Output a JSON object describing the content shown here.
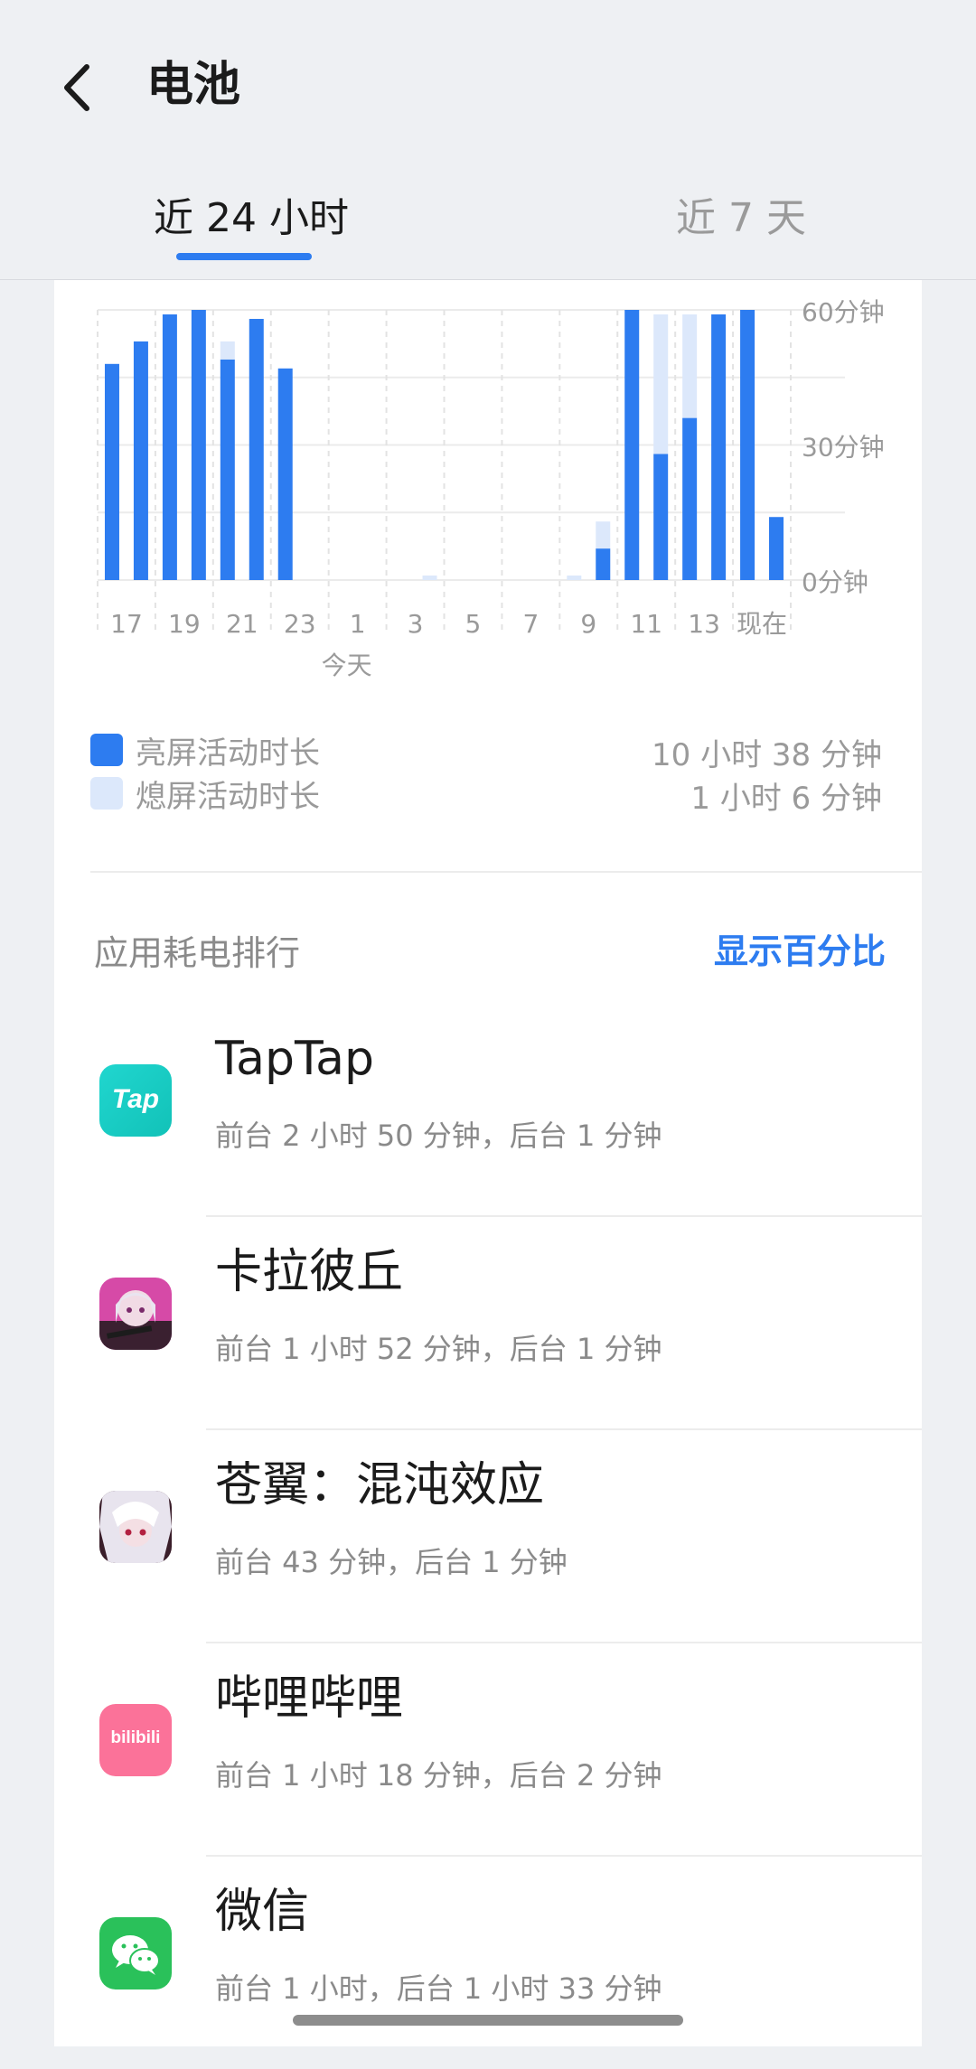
{
  "header": {
    "title": "电池",
    "tabs": [
      {
        "label": "近 24 小时",
        "active": true
      },
      {
        "label": "近 7 天",
        "active": false
      }
    ]
  },
  "chart_data": {
    "type": "bar",
    "stacked": true,
    "x": [
      16,
      17,
      18,
      19,
      20,
      21,
      22,
      23,
      0,
      1,
      2,
      3,
      4,
      5,
      6,
      7,
      8,
      9,
      10,
      11,
      12,
      13,
      14,
      15
    ],
    "x_tick_labels": [
      "17",
      "19",
      "21",
      "23",
      "1",
      "3",
      "5",
      "7",
      "9",
      "11",
      "13",
      "现在"
    ],
    "x_sublabel": "今天",
    "y_tick_labels": [
      "60分钟",
      "30分钟",
      "0分钟"
    ],
    "ylim": [
      0,
      60
    ],
    "series": [
      {
        "name": "亮屏活动时长",
        "color": "#2d7cf0",
        "values": [
          48,
          53,
          59,
          60,
          49,
          58,
          47,
          0,
          0,
          0,
          0,
          0,
          0,
          0,
          0,
          0,
          0,
          7,
          60,
          28,
          36,
          59,
          60,
          14
        ]
      },
      {
        "name": "熄屏活动时长",
        "color": "#dce8fb",
        "values": [
          0,
          0,
          0,
          0,
          4,
          0,
          0,
          0,
          0,
          0,
          0,
          1,
          0,
          0,
          0,
          0,
          1,
          6,
          0,
          31,
          23,
          0,
          0,
          0
        ]
      }
    ],
    "grid": true
  },
  "legend": {
    "items": [
      {
        "label": "亮屏活动时长",
        "value": "10 小时 38 分钟",
        "color": "#2d7cf0"
      },
      {
        "label": "熄屏活动时长",
        "value": "1 小时 6 分钟",
        "color": "#dce8fb"
      }
    ]
  },
  "ranking": {
    "title": "应用耗电排行",
    "toggle_label": "显示百分比",
    "apps": [
      {
        "name": "TapTap",
        "detail": "前台 2 小时 50 分钟，后台 1 分钟",
        "icon": "taptap-app-icon",
        "icon_text": "Tap"
      },
      {
        "name": "卡拉彼丘",
        "detail": "前台 1 小时 52 分钟，后台 1 分钟",
        "icon": "karabichu-app-icon"
      },
      {
        "name": "苍翼：混沌效应",
        "detail": "前台 43 分钟，后台 1 分钟",
        "icon": "blazblue-app-icon"
      },
      {
        "name": "哔哩哔哩",
        "detail": "前台 1 小时 18 分钟，后台 2 分钟",
        "icon": "bilibili-app-icon",
        "icon_text": "bilibili"
      },
      {
        "name": "微信",
        "detail": "前台 1 小时，后台 1 小时 33 分钟",
        "icon": "wechat-app-icon"
      }
    ]
  }
}
